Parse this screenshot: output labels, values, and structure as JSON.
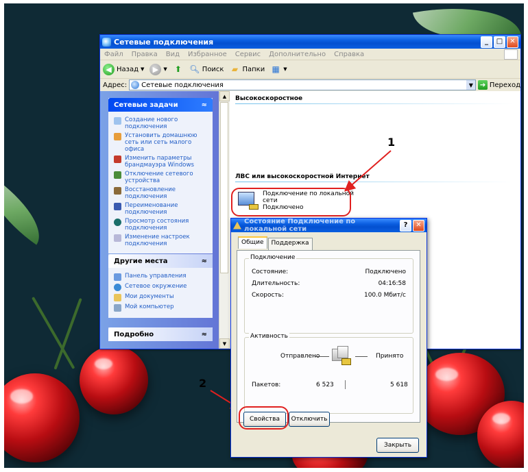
{
  "explorer": {
    "title": "Сетевые подключения",
    "menu": [
      "Файл",
      "Правка",
      "Вид",
      "Избранное",
      "Сервис",
      "Дополнительно",
      "Справка"
    ],
    "toolbar": {
      "back": "Назад",
      "search": "Поиск",
      "folders": "Папки"
    },
    "address": {
      "label": "Адрес:",
      "value": "Сетевые подключения",
      "go": "Переход"
    },
    "taskpane": {
      "network_tasks": {
        "title": "Сетевые задачи",
        "items": [
          "Создание нового подключения",
          "Установить домашнюю сеть или сеть малого офиса",
          "Изменить параметры брандмауэра Windows",
          "Отключение сетевого устройства",
          "Восстановление подключения",
          "Переименование подключения",
          "Просмотр состояния подключения",
          "Изменение настроек подключения"
        ]
      },
      "other_places": {
        "title": "Другие места",
        "items": [
          "Панель управления",
          "Сетевое окружение",
          "Мои документы",
          "Мой компьютер"
        ]
      },
      "details": {
        "title": "Подробно"
      }
    },
    "main": {
      "group1": "Высокоскоростное",
      "group2": "ЛВС или высокоскоростной Интернет",
      "connection": {
        "line1": "Подключение по локальной",
        "line2": "сети",
        "status": "Подключено"
      }
    }
  },
  "dialog": {
    "title": "Состояние Подключение по локальной сети",
    "tabs": [
      "Общие",
      "Поддержка"
    ],
    "connection": {
      "legend": "Подключение",
      "rows": [
        {
          "label": "Состояние:",
          "value": "Подключено"
        },
        {
          "label": "Длительность:",
          "value": "04:16:58"
        },
        {
          "label": "Скорость:",
          "value": "100.0 Мбит/с"
        }
      ]
    },
    "activity": {
      "legend": "Активность",
      "sent": "Отправлено",
      "received": "Принято",
      "packets_label": "Пакетов:",
      "packets_sent": "6 523",
      "packets_received": "5 618"
    },
    "buttons": {
      "properties": "Свойства",
      "disable": "Отключить",
      "close": "Закрыть"
    }
  },
  "annotations": {
    "marker1": "1",
    "marker2": "2",
    "color": "#e0201f"
  }
}
